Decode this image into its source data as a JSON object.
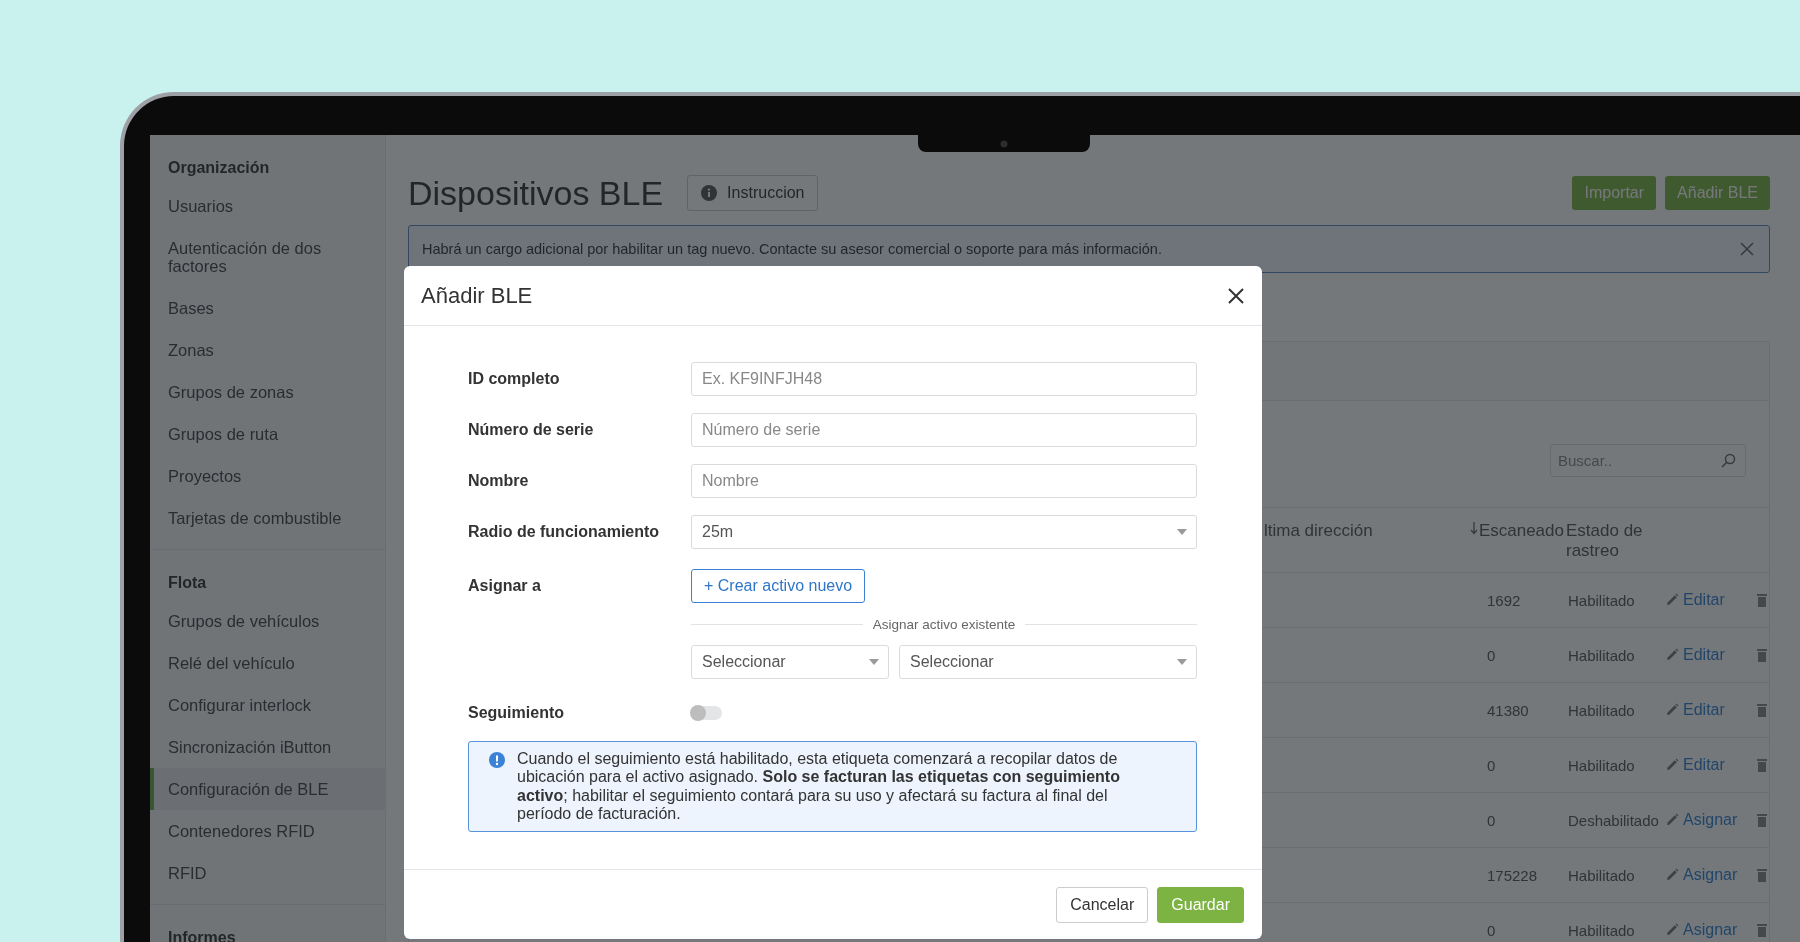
{
  "sidebar": {
    "sections": [
      {
        "title": "Organización",
        "items": [
          {
            "label": "Usuarios",
            "selected": false
          },
          {
            "label": "Autenticación de dos factores",
            "selected": false
          },
          {
            "label": "Bases",
            "selected": false
          },
          {
            "label": "Zonas",
            "selected": false
          },
          {
            "label": "Grupos de zonas",
            "selected": false
          },
          {
            "label": "Grupos de ruta",
            "selected": false
          },
          {
            "label": "Proyectos",
            "selected": false
          },
          {
            "label": "Tarjetas de combustible",
            "selected": false
          }
        ]
      },
      {
        "title": "Flota",
        "items": [
          {
            "label": "Grupos de vehículos",
            "selected": false
          },
          {
            "label": "Relé del vehículo",
            "selected": false
          },
          {
            "label": "Configurar interlock",
            "selected": false
          },
          {
            "label": "Sincronización iButton",
            "selected": false
          },
          {
            "label": "Configuración de BLE",
            "selected": true
          },
          {
            "label": "Contenedores RFID",
            "selected": false
          },
          {
            "label": "RFID",
            "selected": false
          }
        ]
      },
      {
        "title": "Informes"
      }
    ]
  },
  "page": {
    "title": "Dispositivos BLE",
    "help_button": "Instruccion",
    "buttons": [
      "Importar",
      "Añadir BLE"
    ]
  },
  "alert": {
    "text": "Habrá un cargo adicional por habilitar un tag nuevo. Contacte su asesor comercial o soporte para más información."
  },
  "search": {
    "placeholder": "Buscar.."
  },
  "table": {
    "columns": [
      {
        "label": "ltima dirección",
        "sorted": false
      },
      {
        "label": "Escaneado",
        "sorted": true
      },
      {
        "label": "Estado de rastreo",
        "sorted": false
      }
    ],
    "rows": [
      {
        "scanned": "1692",
        "status": "Habilitado",
        "action": "Editar"
      },
      {
        "scanned": "0",
        "status": "Habilitado",
        "action": "Editar"
      },
      {
        "scanned": "41380",
        "status": "Habilitado",
        "action": "Editar"
      },
      {
        "scanned": "0",
        "status": "Habilitado",
        "action": "Editar"
      },
      {
        "scanned": "0",
        "status": "Deshabilitado",
        "action": "Asignar"
      },
      {
        "scanned": "175228",
        "status": "Habilitado",
        "action": "Asignar"
      },
      {
        "scanned": "0",
        "status": "Habilitado",
        "action": "Asignar"
      }
    ]
  },
  "modal": {
    "title": "Añadir BLE",
    "fields": [
      {
        "kind": "text",
        "label": "ID completo",
        "placeholder": "Ex. KF9INFJH48"
      },
      {
        "kind": "text",
        "label": "Número de serie",
        "placeholder": "Número de serie"
      },
      {
        "kind": "text",
        "label": "Nombre",
        "placeholder": "Nombre"
      },
      {
        "kind": "select",
        "label": "Radio de funcionamiento",
        "value": "25m"
      },
      {
        "kind": "assign",
        "label": "Asignar a",
        "button": "+ Crear activo nuevo",
        "divider": "Asignar activo existente",
        "selects": [
          "Seleccionar",
          "Seleccionar"
        ]
      },
      {
        "kind": "toggle",
        "label": "Seguimiento",
        "on": false
      }
    ],
    "note": "Cuando el seguimiento está habilitado, esta etiqueta comenzará a recopilar datos de ubicación para el activo asignado. **Solo se facturan las etiquetas con seguimiento activo**; habilitar el seguimiento contará para su uso y afectará su factura al final del período de facturación.",
    "buttons": [
      {
        "label": "Cancelar",
        "kind": "secondary"
      },
      {
        "label": "Guardar",
        "kind": "primary"
      }
    ]
  }
}
